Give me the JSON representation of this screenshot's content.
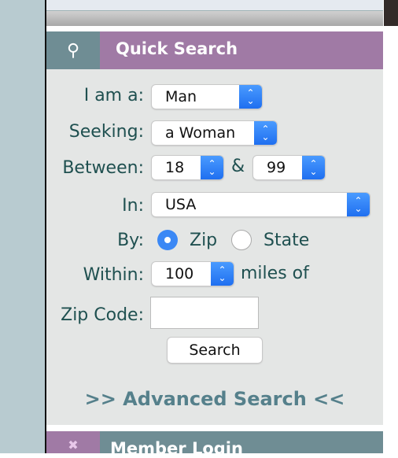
{
  "quick_search": {
    "title": "Quick Search",
    "icon": "magnifier-icon",
    "i_am_label": "I am a:",
    "i_am_value": "Man",
    "seeking_label": "Seeking:",
    "seeking_value": "a Woman",
    "between_label": "Between:",
    "age_min": "18",
    "and": "&",
    "age_max": "99",
    "in_label": "In:",
    "country": "USA",
    "by_label": "By:",
    "by_zip": "Zip",
    "by_state": "State",
    "by_selected": "Zip",
    "within_label": "Within:",
    "within_value": "100",
    "miles_of": "miles of",
    "zip_label": "Zip Code:",
    "zip_value": "",
    "search_button": "Search",
    "advanced_link": ">> Advanced Search <<"
  },
  "member_login": {
    "title": "Member Login",
    "icon": "cross-icon"
  },
  "colors": {
    "purple": "#a07aa5",
    "teal": "#6f8d94",
    "label": "#1f5050",
    "link": "#55808b"
  }
}
